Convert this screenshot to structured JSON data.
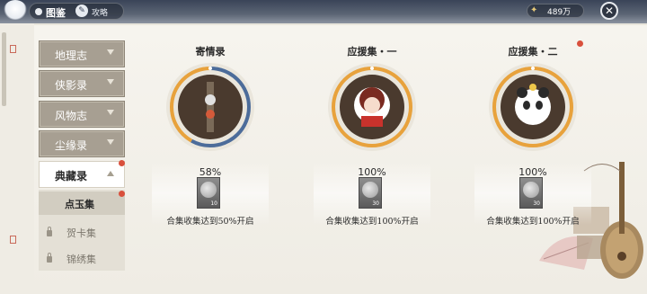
{
  "header": {
    "title": "图鉴",
    "guide_label": "攻略",
    "currency_value": "489万"
  },
  "sidebar": {
    "items": [
      {
        "label": "地理志"
      },
      {
        "label": "侠影录"
      },
      {
        "label": "风物志"
      },
      {
        "label": "尘缘录"
      }
    ],
    "active": {
      "label": "典藏录"
    },
    "subitems": [
      {
        "label": "点玉集",
        "locked": false
      },
      {
        "label": "贺卡集",
        "locked": true
      },
      {
        "label": "锦绣集",
        "locked": true
      }
    ]
  },
  "cards": [
    {
      "title": "寄情录",
      "percent_label": "58%",
      "progress": 0.58,
      "item_count": "10",
      "condition": "合集收集达到50%开启",
      "has_red_dot": false
    },
    {
      "title": "应援集・一",
      "percent_label": "100%",
      "progress": 1.0,
      "item_count": "30",
      "condition": "合集收集达到100%开启",
      "has_red_dot": false
    },
    {
      "title": "应援集・二",
      "percent_label": "100%",
      "progress": 1.0,
      "item_count": "30",
      "condition": "合集收集达到100%开启",
      "has_red_dot": true
    }
  ],
  "colors": {
    "progress_orange": "#e8a23c",
    "progress_blue": "#4c6c9a",
    "alert_red": "#d9503c",
    "tab_gray": "#a79f92"
  }
}
